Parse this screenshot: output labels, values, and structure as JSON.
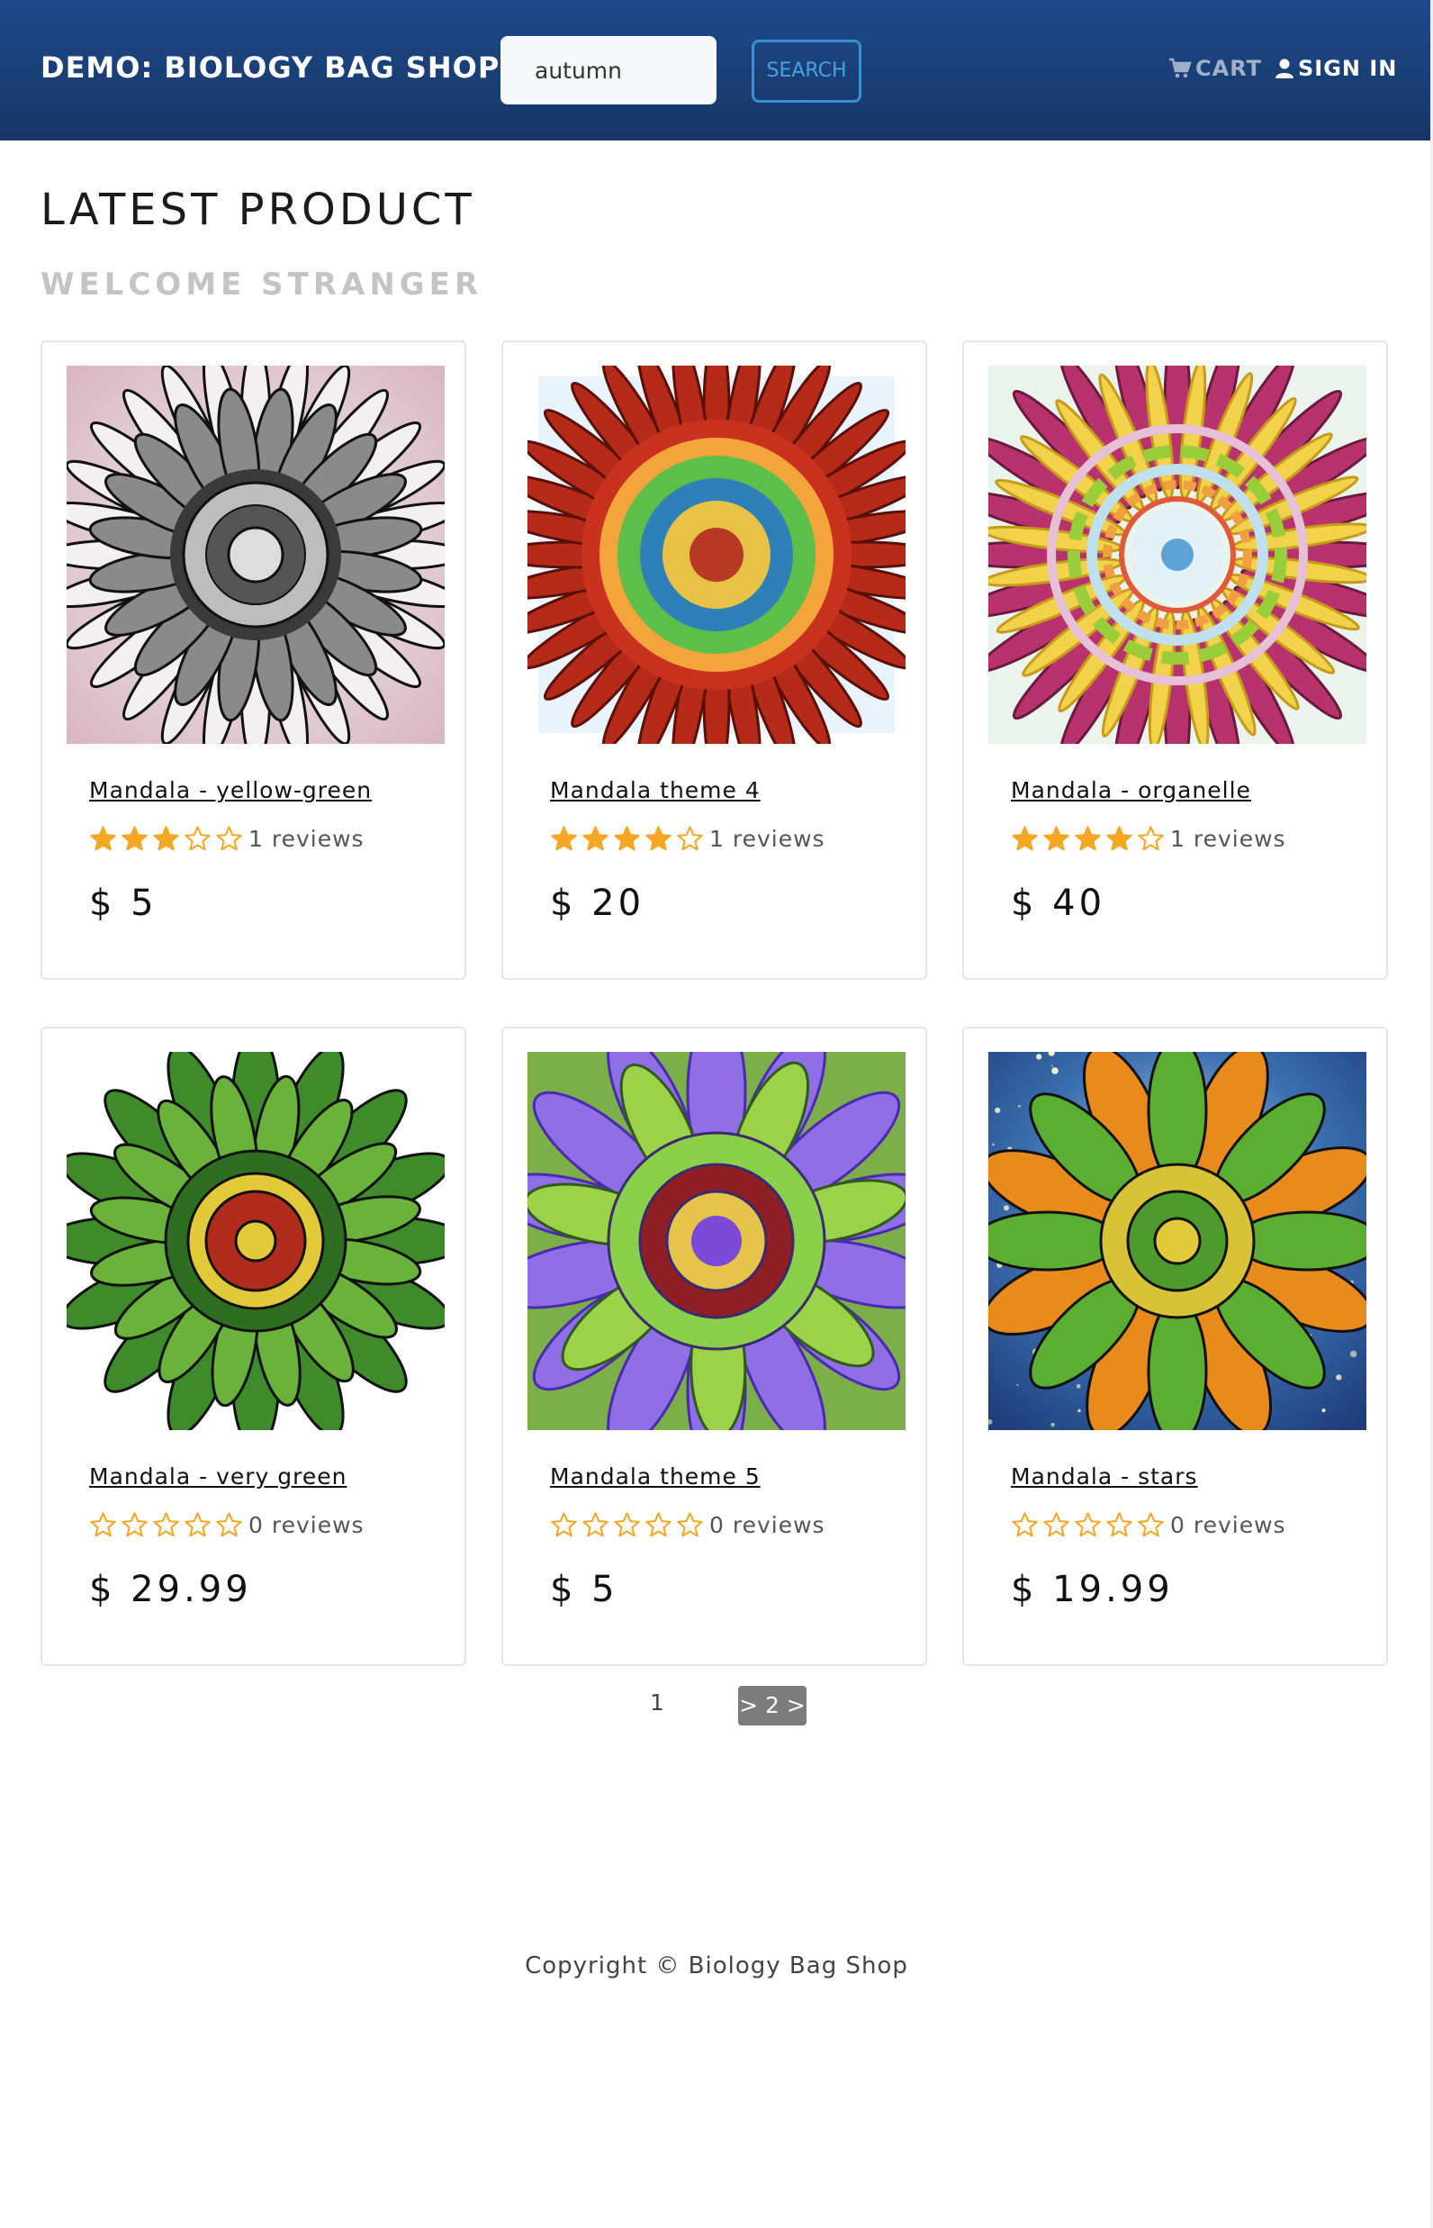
{
  "header": {
    "brand": "DEMO: BIOLOGY BAG SHOP",
    "search_value": "autumn",
    "search_button": "SEARCH",
    "cart_label": "CART",
    "signin_label": "SIGN IN"
  },
  "main": {
    "title": "LATEST PRODUCT",
    "subtitle": "WELCOME STRANGER"
  },
  "products": [
    {
      "name": "Mandala - yellow-green",
      "rating": 3,
      "reviews": "1 reviews",
      "price": "$ 5"
    },
    {
      "name": "Mandala theme 4",
      "rating": 4,
      "reviews": "1 reviews",
      "price": "$ 20"
    },
    {
      "name": "Mandala - organelle",
      "rating": 4,
      "reviews": "1 reviews",
      "price": "$ 40"
    },
    {
      "name": "Mandala - very green",
      "rating": 0,
      "reviews": "0 reviews",
      "price": "$ 29.99"
    },
    {
      "name": "Mandala theme 5",
      "rating": 0,
      "reviews": "0 reviews",
      "price": "$ 5"
    },
    {
      "name": "Mandala - stars",
      "rating": 0,
      "reviews": "0 reviews",
      "price": "$ 19.99"
    }
  ],
  "pagination": {
    "page1": "1",
    "page2": "> 2 >"
  },
  "footer": {
    "copyright": "Copyright © Biology Bag Shop"
  },
  "colors": {
    "navbar": "#1e4a8b",
    "star": "#f5a623"
  }
}
